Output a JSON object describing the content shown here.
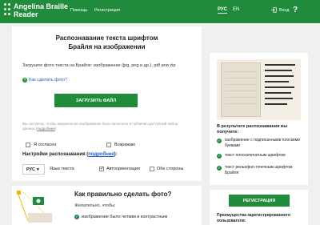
{
  "header": {
    "brand_line1": "Angelina Braille",
    "brand_line2": "Reader",
    "nav_help": "Помощь",
    "nav_register": "Регистрация",
    "lang_ru": "РУС",
    "lang_en": "EN",
    "login": "Вход",
    "help_icon": "?",
    "colors": {
      "brand": "#1f8b3b"
    }
  },
  "main": {
    "title_line1": "Распознавание текста шрифтом",
    "title_line2": "Брайля на изображении",
    "hint": "Загрузите фото текста на Брайле: изображение (jpg, png и др.), pdf или zip",
    "howto_link": "Как сделать фото?",
    "upload_button": "ЗАГРУЗИТЬ ФАЙЛ",
    "consent_text": "Вы согласны, чтобы загруженное изображение было включено в публично доступный набор данных (",
    "consent_link": "подробнее",
    "consent_end": "):",
    "agree": "Я согласен",
    "disagree": "Возражаю",
    "settings_label": "Настройки распознавания (",
    "settings_link": "подробнее",
    "settings_end": "):",
    "lang_select": "РУС",
    "lang_text_label": "Язык текста",
    "auto_orient": "Автоориентация",
    "both_sides": "Обе стороны",
    "auto_orient_checked": true,
    "both_sides_checked": false
  },
  "side": {
    "result_title": "В результате распознавания вы получите:",
    "items": [
      "изображение с подписанными плоскими буквами",
      "текст плоскопечатным шрифтом",
      "текст рельефно-точечным шрифтом Брайля"
    ]
  },
  "bottom": {
    "title": "Как правильно сделать фото?",
    "subtitle": "Желательно, чтобы:",
    "item1": "изображение было четким и контрастным"
  },
  "register": {
    "button": "РЕГИСТРАЦИЯ",
    "text": "Преимущества зарегистрированного пользователя:"
  }
}
